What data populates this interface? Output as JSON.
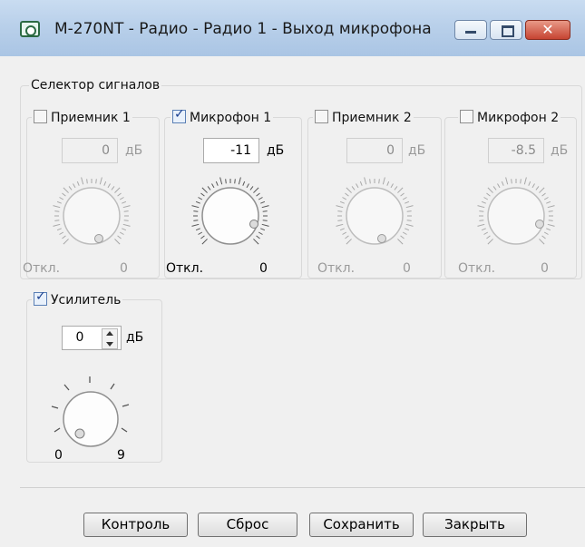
{
  "window": {
    "title": "M-270NT - Радио - Радио 1 - Выход микрофона",
    "close_glyph": "✕"
  },
  "signal_selector": {
    "title": "Селектор сигналов",
    "channels": [
      {
        "label": "Приемник 1",
        "checked": false,
        "value": "0",
        "unit": "дБ",
        "off_label": "Откл.",
        "zero_label": "0"
      },
      {
        "label": "Микрофон 1",
        "checked": true,
        "value": "-11",
        "unit": "дБ",
        "off_label": "Откл.",
        "zero_label": "0"
      },
      {
        "label": "Приемник 2",
        "checked": false,
        "value": "0",
        "unit": "дБ",
        "off_label": "Откл.",
        "zero_label": "0"
      },
      {
        "label": "Микрофон 2",
        "checked": false,
        "value": "-8.5",
        "unit": "дБ",
        "off_label": "Откл.",
        "zero_label": "0"
      }
    ]
  },
  "amplifier": {
    "label": "Усилитель",
    "checked": true,
    "value": "0",
    "unit": "дБ",
    "min_label": "0",
    "max_label": "9"
  },
  "buttons": {
    "monitor": "Контроль",
    "reset": "Сброс",
    "save": "Сохранить",
    "close": "Закрыть"
  },
  "colors": {
    "titlebar": "#b9d0ea",
    "client_bg": "#f0f0f0",
    "close_button": "#c64432"
  },
  "icons": {
    "app": "app-icon",
    "minimize": "minimize-icon",
    "maximize": "maximize-icon",
    "close": "close-icon",
    "checkbox_checked": "checkbox-checked-icon",
    "spin_arrows": "spin-arrows-icon"
  }
}
